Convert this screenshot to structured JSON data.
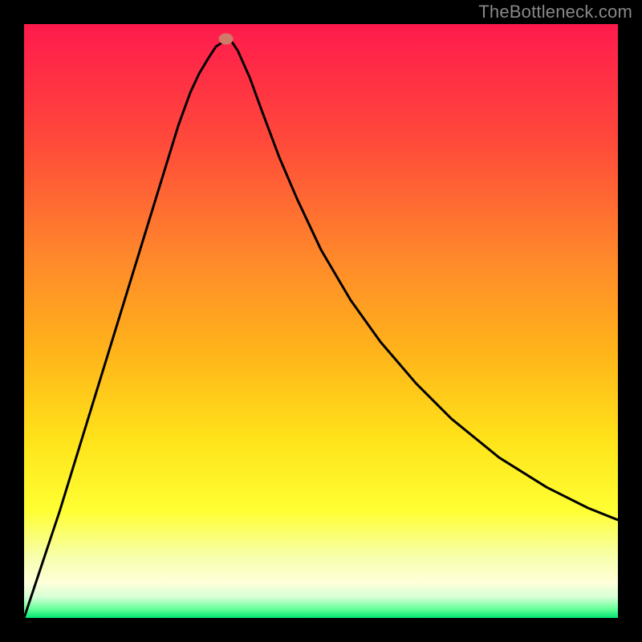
{
  "watermark": "TheBottleneck.com",
  "chart_data": {
    "type": "line",
    "title": "",
    "xlabel": "",
    "ylabel": "",
    "xlim": [
      0,
      100
    ],
    "ylim": [
      0,
      100
    ],
    "gradient_stops": [
      {
        "offset": 0.0,
        "color": "#ff1a4d"
      },
      {
        "offset": 0.2,
        "color": "#ff4a3a"
      },
      {
        "offset": 0.4,
        "color": "#ff8a2a"
      },
      {
        "offset": 0.55,
        "color": "#ffb31a"
      },
      {
        "offset": 0.7,
        "color": "#ffe31a"
      },
      {
        "offset": 0.82,
        "color": "#ffff33"
      },
      {
        "offset": 0.9,
        "color": "#f7ffb0"
      },
      {
        "offset": 0.94,
        "color": "#ffffd8"
      },
      {
        "offset": 0.965,
        "color": "#d6ffd6"
      },
      {
        "offset": 0.985,
        "color": "#66ff99"
      },
      {
        "offset": 1.0,
        "color": "#00e673"
      }
    ],
    "marker": {
      "x": 34,
      "y": 97.5,
      "color": "#d07a6a"
    },
    "series": [
      {
        "name": "curve",
        "x": [
          0,
          2,
          4,
          6,
          8,
          10,
          12,
          14,
          16,
          18,
          20,
          22,
          24,
          26,
          28,
          29.5,
          31,
          32.3,
          33.5,
          34,
          35,
          36,
          38,
          40,
          43,
          46,
          50,
          55,
          60,
          66,
          72,
          80,
          88,
          95,
          100
        ],
        "y": [
          0,
          6,
          12,
          18,
          24.5,
          31,
          37.5,
          44,
          50.5,
          57,
          63.5,
          70,
          76.5,
          83,
          88.5,
          91.7,
          94.2,
          96.2,
          97,
          97.3,
          97,
          95.5,
          91,
          85.5,
          77.5,
          70.5,
          62,
          53.5,
          46.5,
          39.5,
          33.5,
          27,
          22,
          18.5,
          16.5
        ]
      }
    ]
  }
}
